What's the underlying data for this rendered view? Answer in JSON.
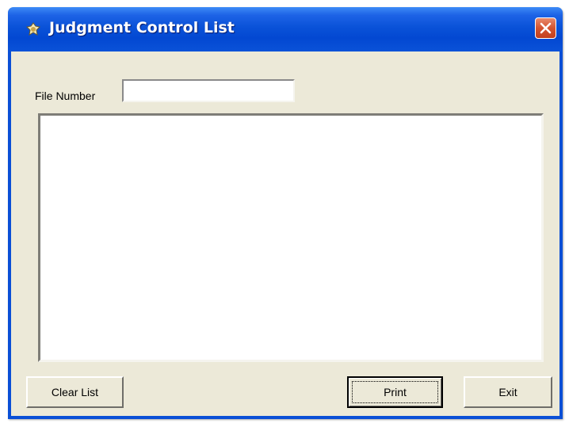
{
  "window": {
    "title": "Judgment Control List",
    "icon": "app-icon",
    "close_icon": "close-icon",
    "titlebar_color": "#0a52d8",
    "close_color": "#d4542f",
    "face_color": "#ece9d8"
  },
  "form": {
    "file_number_label": "File Number",
    "file_number_value": "",
    "list_items": []
  },
  "buttons": {
    "clear_label": "Clear List",
    "print_label": "Print",
    "exit_label": "Exit"
  }
}
